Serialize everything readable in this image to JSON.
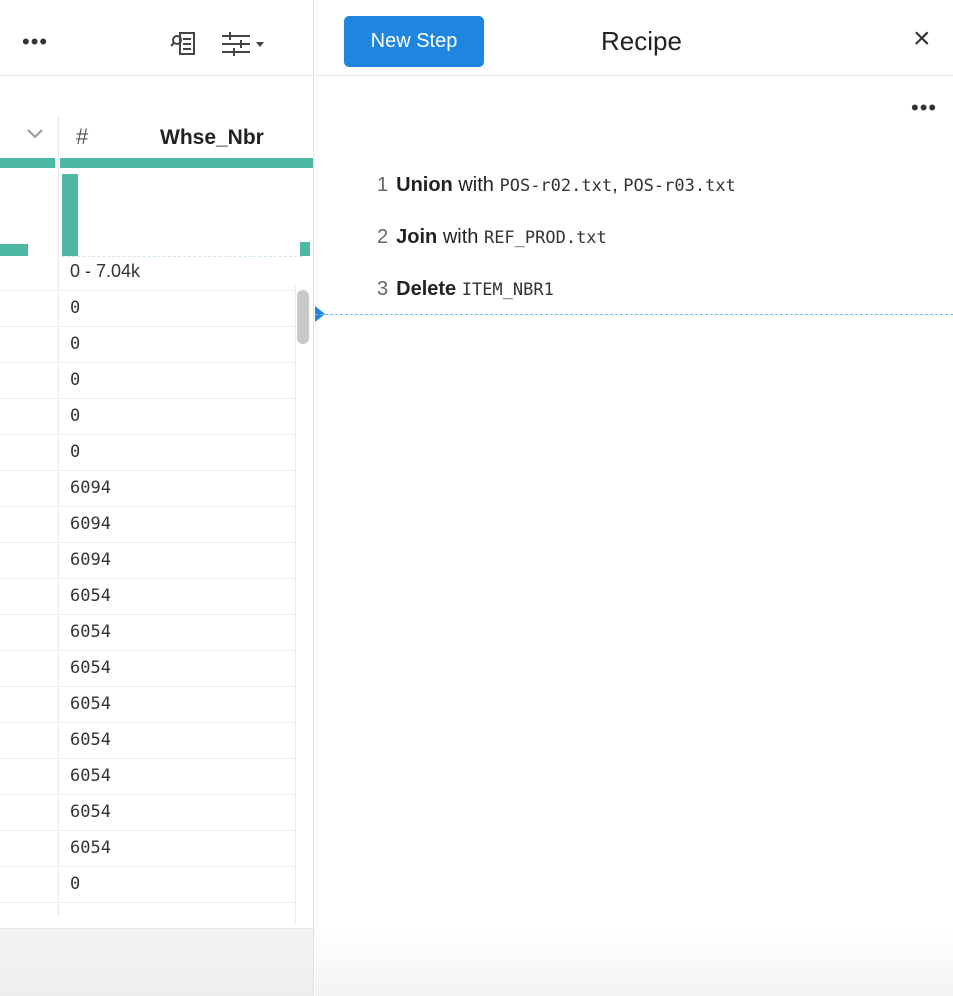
{
  "grid": {
    "more_label": "•••",
    "column": {
      "type_symbol": "#",
      "name": "Whse_Nbr",
      "range_label": "0 - 7.04k",
      "values": [
        "0",
        "0",
        "0",
        "0",
        "0",
        "6094",
        "6094",
        "6094",
        "6054",
        "6054",
        "6054",
        "6054",
        "6054",
        "6054",
        "6054",
        "6054",
        "0"
      ]
    },
    "icons": [
      "chevron-down-icon",
      "column-details-icon",
      "filter-sliders-icon"
    ]
  },
  "recipe": {
    "new_step_label": "New Step",
    "title": "Recipe",
    "close_label": "×",
    "more_label": "•••",
    "steps": [
      {
        "num": "1",
        "verb": "Union",
        "rest": "with",
        "args": "POS-r02.txt",
        "sep": ",",
        "args2": "POS-r03.txt"
      },
      {
        "num": "2",
        "verb": "Join",
        "rest": "with",
        "args": "REF_PROD.txt"
      },
      {
        "num": "3",
        "verb": "Delete",
        "rest": "",
        "args": "ITEM_NBR1"
      }
    ],
    "accent_color": "#1f86e0",
    "histogram_color": "#4db8a3"
  }
}
